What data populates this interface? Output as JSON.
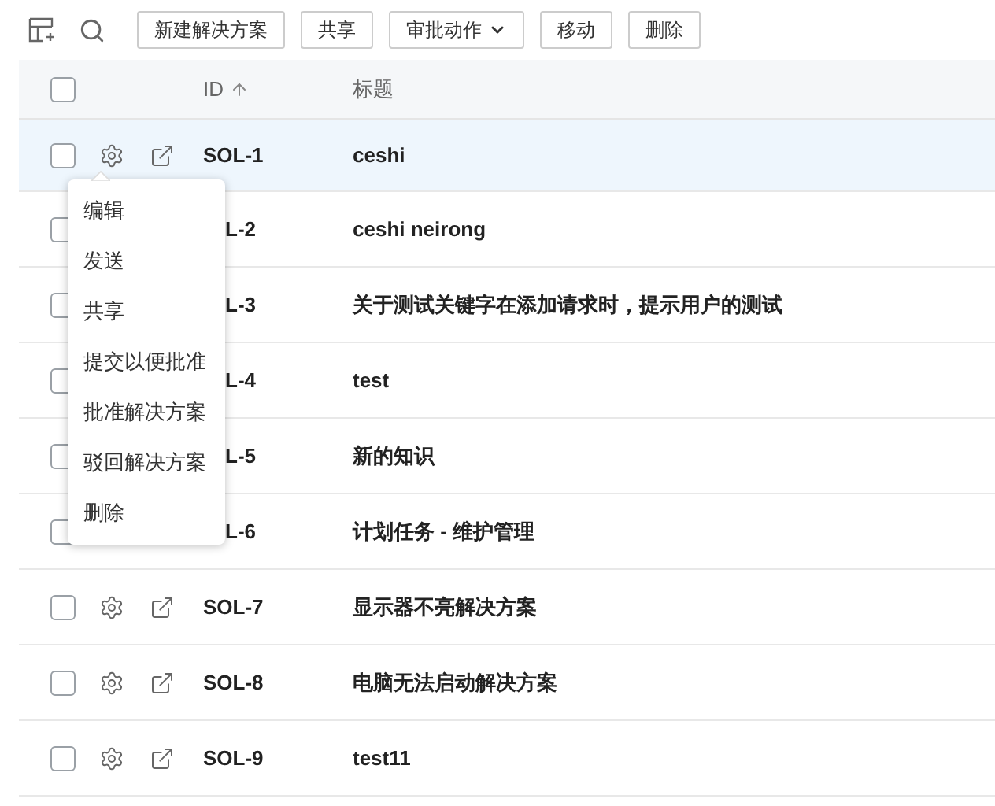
{
  "toolbar": {
    "buttons": [
      {
        "label": "新建解决方案",
        "kind": "plain"
      },
      {
        "label": "共享",
        "kind": "plain"
      },
      {
        "label": "审批动作",
        "kind": "dropdown"
      },
      {
        "label": "移动",
        "kind": "plain"
      },
      {
        "label": "删除",
        "kind": "plain"
      }
    ]
  },
  "table": {
    "select_all_checked": false,
    "columns": [
      {
        "label": "ID",
        "sorted": true
      },
      {
        "label": "标题",
        "sorted": false
      }
    ],
    "rows": [
      {
        "id": "SOL-1",
        "title": "ceshi",
        "selected": true,
        "covered": false,
        "checked": false
      },
      {
        "id": "L-2",
        "title": "ceshi neirong",
        "selected": false,
        "covered": true,
        "checked": false
      },
      {
        "id": "L-3",
        "title": "关于测试关键字在添加请求时，提示用户的测试",
        "selected": false,
        "covered": true,
        "checked": false
      },
      {
        "id": "L-4",
        "title": "test",
        "selected": false,
        "covered": true,
        "checked": false
      },
      {
        "id": "L-5",
        "title": "新的知识",
        "selected": false,
        "covered": true,
        "checked": false
      },
      {
        "id": "L-6",
        "title": "计划任务 - 维护管理",
        "selected": false,
        "covered": true,
        "checked": false
      },
      {
        "id": "SOL-7",
        "title": "显示器不亮解决方案",
        "selected": false,
        "covered": false,
        "checked": false
      },
      {
        "id": "SOL-8",
        "title": "电脑无法启动解决方案",
        "selected": false,
        "covered": false,
        "checked": false
      },
      {
        "id": "SOL-9",
        "title": "test11",
        "selected": false,
        "covered": false,
        "checked": false
      }
    ]
  },
  "context_menu": {
    "items": [
      "编辑",
      "发送",
      "共享",
      "提交以便批准",
      "批准解决方案",
      "驳回解决方案",
      "删除"
    ]
  }
}
